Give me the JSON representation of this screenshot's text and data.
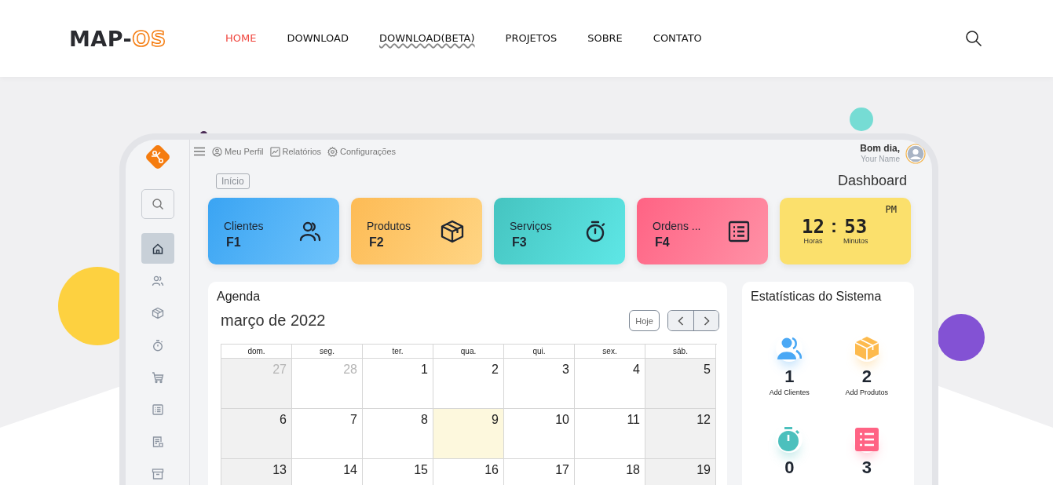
{
  "header": {
    "logo": {
      "text": "MAP-",
      "accent": "OS"
    },
    "nav": [
      {
        "label": "HOME",
        "selected": true,
        "underlined": false
      },
      {
        "label": "DOWNLOAD",
        "selected": false,
        "underlined": false
      },
      {
        "label": "DOWNLOAD(BETA)",
        "selected": false,
        "underlined": true
      },
      {
        "label": "PROJETOS",
        "selected": false,
        "underlined": false
      },
      {
        "label": "SOBRE",
        "selected": false,
        "underlined": false
      },
      {
        "label": "CONTATO",
        "selected": false,
        "underlined": false
      }
    ]
  },
  "sidebar": {
    "items": [
      {
        "kind": "home",
        "selected": true
      },
      {
        "kind": "users",
        "selected": false
      },
      {
        "kind": "box",
        "selected": false
      },
      {
        "kind": "timer",
        "selected": false
      },
      {
        "kind": "cart",
        "selected": false
      },
      {
        "kind": "list",
        "selected": false
      },
      {
        "kind": "receipt",
        "selected": false
      },
      {
        "kind": "archive",
        "selected": false
      }
    ]
  },
  "topbar": {
    "links": [
      {
        "kind": "user",
        "label": "Meu Perfil"
      },
      {
        "kind": "chart",
        "label": "Relatórios"
      },
      {
        "kind": "gear",
        "label": "Configurações"
      }
    ],
    "greeting": "Bom dia,",
    "user_name": "Your Name"
  },
  "breadcrumb": "Início",
  "page_title": "Dashboard",
  "cards": [
    {
      "kind": "clients",
      "label": "Clientes",
      "key": "F1"
    },
    {
      "kind": "products",
      "label": "Produtos",
      "key": "F2"
    },
    {
      "kind": "services",
      "label": "Serviços",
      "key": "F3"
    },
    {
      "kind": "orders",
      "label": "Ordens ...",
      "key": "F4"
    }
  ],
  "clock": {
    "period": "PM",
    "hours": "12",
    "separator": ":",
    "minutes": "53",
    "hours_label": "Horas",
    "minutes_label": "Minutos"
  },
  "agenda": {
    "title": "Agenda",
    "month": "março de 2022",
    "today_button": "Hoje",
    "weekdays": [
      "dom.",
      "seg.",
      "ter.",
      "qua.",
      "qui.",
      "sex.",
      "sáb."
    ],
    "weeks": [
      [
        {
          "day": "27",
          "outside": true,
          "today": false
        },
        {
          "day": "28",
          "outside": true,
          "today": false
        },
        {
          "day": "1",
          "outside": false,
          "today": false
        },
        {
          "day": "2",
          "outside": false,
          "today": false
        },
        {
          "day": "3",
          "outside": false,
          "today": false
        },
        {
          "day": "4",
          "outside": false,
          "today": false
        },
        {
          "day": "5",
          "outside": false,
          "today": false
        }
      ],
      [
        {
          "day": "6",
          "outside": false,
          "today": false
        },
        {
          "day": "7",
          "outside": false,
          "today": false
        },
        {
          "day": "8",
          "outside": false,
          "today": false
        },
        {
          "day": "9",
          "outside": false,
          "today": true
        },
        {
          "day": "10",
          "outside": false,
          "today": false
        },
        {
          "day": "11",
          "outside": false,
          "today": false
        },
        {
          "day": "12",
          "outside": false,
          "today": false
        }
      ],
      [
        {
          "day": "13",
          "outside": false,
          "today": false
        },
        {
          "day": "14",
          "outside": false,
          "today": false
        },
        {
          "day": "15",
          "outside": false,
          "today": false
        },
        {
          "day": "16",
          "outside": false,
          "today": false
        },
        {
          "day": "17",
          "outside": false,
          "today": false
        },
        {
          "day": "18",
          "outside": false,
          "today": false
        },
        {
          "day": "19",
          "outside": false,
          "today": false
        }
      ]
    ]
  },
  "stats": {
    "title": "Estatísticas do Sistema",
    "items": [
      {
        "kind": "clients",
        "value": "1",
        "label": "Add Clientes"
      },
      {
        "kind": "products",
        "value": "2",
        "label": "Add Produtos"
      },
      {
        "kind": "services",
        "value": "0"
      },
      {
        "kind": "orders",
        "value": "3"
      }
    ]
  }
}
